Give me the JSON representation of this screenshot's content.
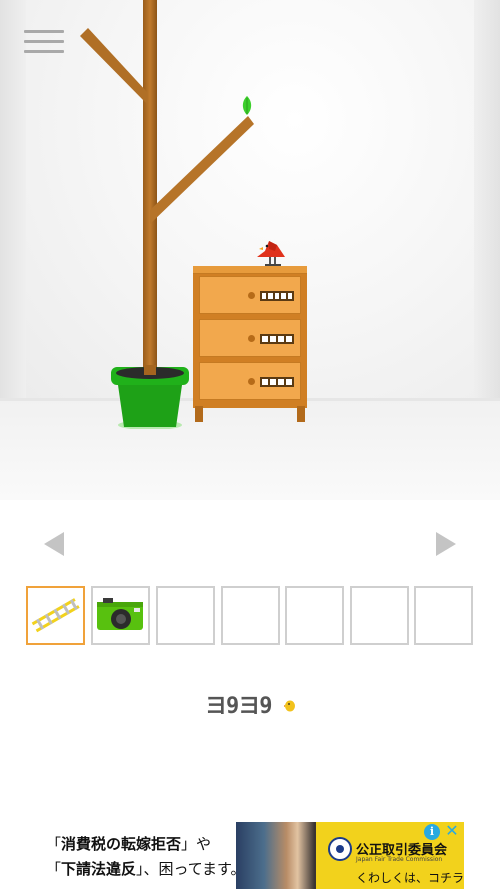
{
  "scene": {
    "room": "room-1",
    "objects": [
      "tree-branch",
      "flowerpot",
      "chest-of-drawers",
      "red-bird",
      "green-leaf"
    ],
    "drawer_codes": [
      5,
      4,
      4
    ]
  },
  "menu": {
    "icon": "hamburger-menu-icon"
  },
  "navigation": {
    "left_icon": "triangle-left-icon",
    "right_icon": "triangle-right-icon"
  },
  "inventory": {
    "slots": [
      {
        "item": "ladder",
        "selected": true
      },
      {
        "item": "camera",
        "selected": false
      },
      {
        "item": "",
        "selected": false
      },
      {
        "item": "",
        "selected": false
      },
      {
        "item": "",
        "selected": false
      },
      {
        "item": "",
        "selected": false
      },
      {
        "item": "",
        "selected": false
      }
    ]
  },
  "logo": {
    "text": "ヨ9ヨ9"
  },
  "ad": {
    "line1_pre": "「",
    "line1_bold": "消費税の転嫁拒否",
    "line1_post": "」や",
    "line2_pre": "「",
    "line2_bold": "下請法違反",
    "line2_post": "」、困ってます。",
    "org": "公正取引委員会",
    "sub": "Japan Fair Trade Commission",
    "cta": "くわしくは、コチラへ",
    "info": "i",
    "close": "✕"
  },
  "colors": {
    "accent_selected": "#f0a23a",
    "chest": "#f2a84d",
    "pot": "#21a51a",
    "bird": "#e0321c",
    "ad_yellow": "#f2d21c"
  }
}
